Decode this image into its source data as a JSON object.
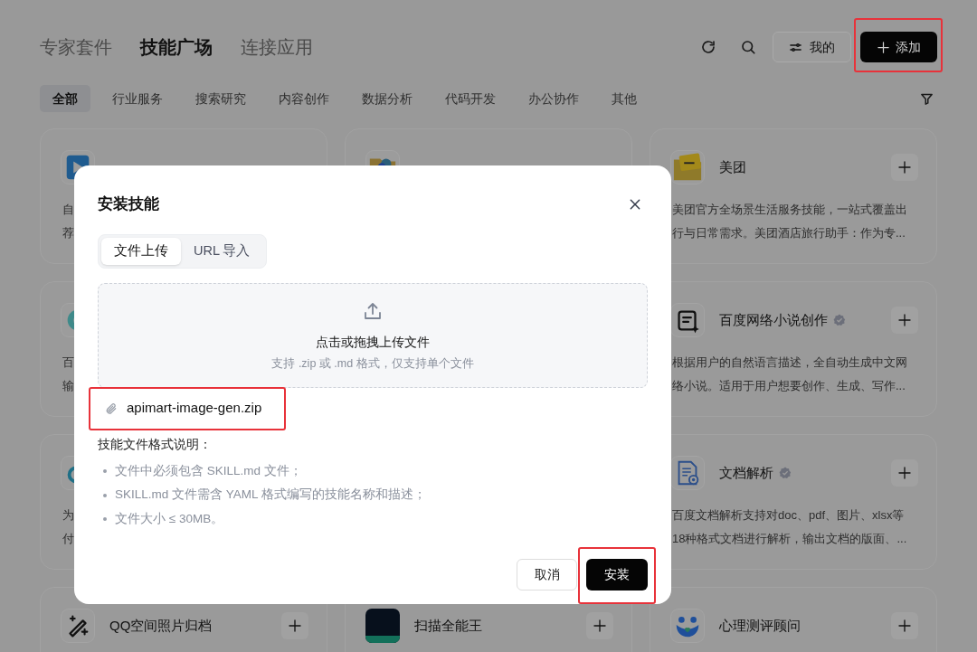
{
  "header": {
    "tabs": [
      {
        "label": "专家套件",
        "selected": false
      },
      {
        "label": "技能广场",
        "selected": true
      },
      {
        "label": "连接应用",
        "selected": false
      }
    ],
    "my_button": "我的",
    "add_button": {
      "label": "添加",
      "highlighted": true
    }
  },
  "categories": [
    {
      "label": "全部",
      "selected": true
    },
    {
      "label": "行业服务",
      "selected": false
    },
    {
      "label": "搜索研究",
      "selected": false
    },
    {
      "label": "内容创作",
      "selected": false
    },
    {
      "label": "数据分析",
      "selected": false
    },
    {
      "label": "代码开发",
      "selected": false
    },
    {
      "label": "办公协作",
      "selected": false
    },
    {
      "label": "其他",
      "selected": false
    }
  ],
  "columns": [
    {
      "cards": [
        {
          "kind": "play",
          "description": [
            "自",
            "荐"
          ]
        },
        {
          "kind": "ring",
          "description": [
            "百",
            "输"
          ]
        },
        {
          "kind": "swirl",
          "description": [
            "为",
            "付"
          ]
        },
        {
          "kind": "wand",
          "title": "QQ空间照片归档",
          "add_button": true
        }
      ]
    },
    {
      "cards": [
        {
          "kind": "folder"
        },
        {
          "kind": "cs",
          "title": "扫描全能王",
          "add_button": true
        }
      ]
    },
    {
      "cards": [
        {
          "kind": "meituan",
          "title": "美团",
          "add_button": true,
          "description": [
            "美团官方全场景生活服务技能，一站式覆盖出",
            "行与日常需求。美团酒店旅行助手：作为专..."
          ]
        },
        {
          "kind": "note",
          "title": "百度网络小说创作",
          "verified": true,
          "add_button": true,
          "description": [
            "根据用户的自然语言描述，全自动生成中文网",
            "络小说。适用于用户想要创作、生成、写作..."
          ]
        },
        {
          "kind": "doc",
          "title": "文档解析",
          "verified": true,
          "add_button": true,
          "description": [
            "百度文档解析支持对doc、pdf、图片、xlsx等",
            "18种格式文档进行解析，输出文档的版面、..."
          ]
        },
        {
          "kind": "people",
          "title": "心理测评顾问",
          "add_button": true
        }
      ]
    }
  ],
  "dialog": {
    "title": "安装技能",
    "tabs": [
      {
        "label": "文件上传",
        "selected": true
      },
      {
        "label": "URL 导入",
        "selected": false
      }
    ],
    "dropzone": {
      "title": "点击或拖拽上传文件",
      "hint": "支持 .zip 或 .md 格式，仅支持单个文件"
    },
    "file": {
      "name": "apimart-image-gen.zip",
      "highlighted": true
    },
    "notes_title": "技能文件格式说明：",
    "notes": [
      "文件中必须包含 SKILL.md 文件；",
      "SKILL.md 文件需含 YAML 格式编写的技能名称和描述；",
      "文件大小 ≤ 30MB。"
    ],
    "cancel_button": "取消",
    "install_button": {
      "label": "安装",
      "highlighted": true
    }
  }
}
